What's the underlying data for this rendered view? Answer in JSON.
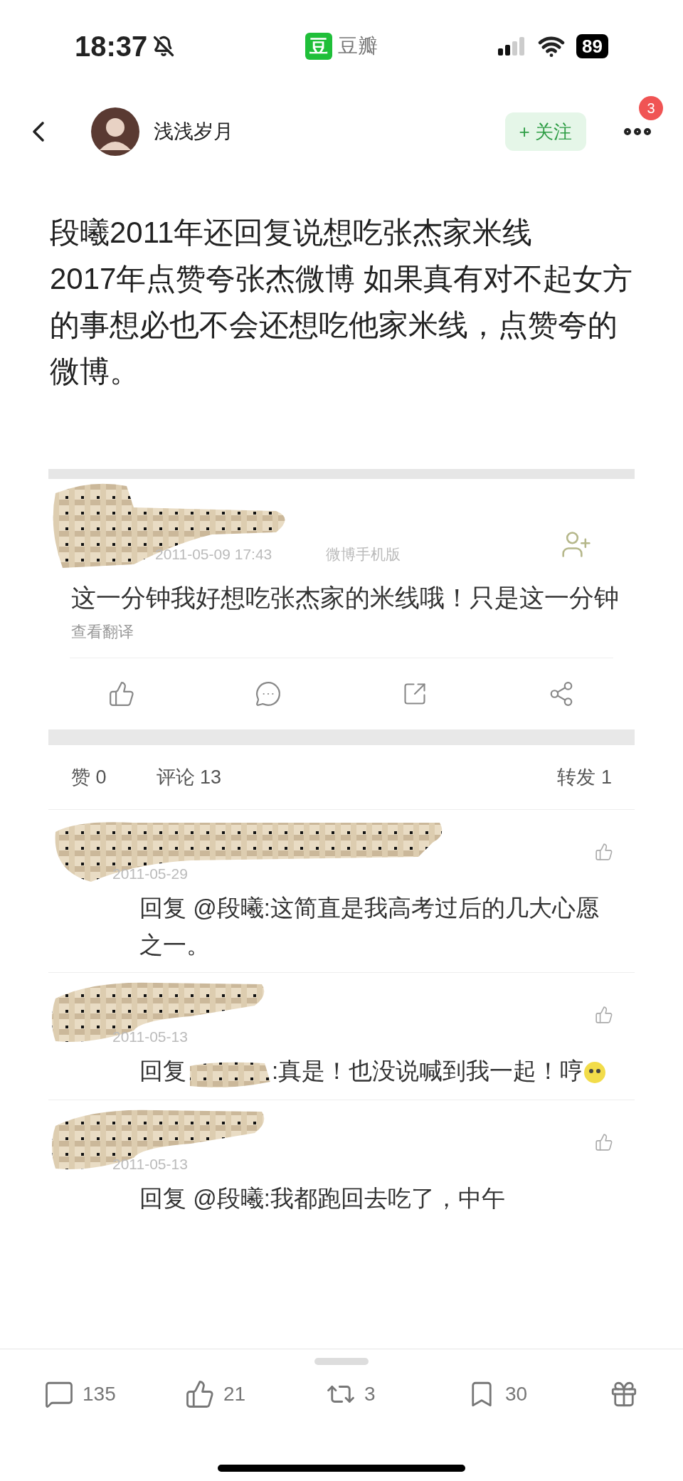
{
  "status_bar": {
    "time": "18:37",
    "app_badge": "豆",
    "app_name": "豆瓣",
    "battery": "89"
  },
  "header": {
    "username": "浅浅岁月",
    "follow_button": "+ 关注",
    "badge": "3"
  },
  "post": {
    "paragraphs": [
      "段曦2011年还回复说想吃张杰家米线",
      "2017年点赞夸张杰微博 如果真有对不起女方的事想必也不会还想吃他家米线，点赞夸的微博。"
    ]
  },
  "embedded_post": {
    "timestamp": "2011-05-09 17:43",
    "source": "微博手机版",
    "text": "这一分钟我好想吃张杰家的米线哦！只是这一分钟",
    "translate_link": "查看翻译",
    "stats": [
      {
        "label": "赞",
        "count": "0"
      },
      {
        "label": "评论",
        "count": "13"
      },
      {
        "label": "转发",
        "count": "1"
      }
    ],
    "comments": [
      {
        "date": "2011-05-29",
        "parts": [
          {
            "kind": "text",
            "text": "回复 @段曦:这简直是我高考过后的几大心愿之一。"
          }
        ]
      },
      {
        "date": "2011-05-13",
        "parts": [
          {
            "kind": "text",
            "text": "回复"
          },
          {
            "kind": "redacted"
          },
          {
            "kind": "text",
            "text": ":真是！也没说喊到我一起！哼"
          },
          {
            "kind": "emoji"
          }
        ]
      },
      {
        "date": "2011-05-13",
        "parts": [
          {
            "kind": "text",
            "text": "回复 @段曦:我都跑回去吃了，中午"
          }
        ]
      }
    ]
  },
  "bottom_bar": [
    {
      "kind": "comment",
      "count": "135"
    },
    {
      "kind": "like",
      "count": "21"
    },
    {
      "kind": "repost",
      "count": "3"
    },
    {
      "kind": "bookmark",
      "count": "30"
    },
    {
      "kind": "gift"
    }
  ]
}
